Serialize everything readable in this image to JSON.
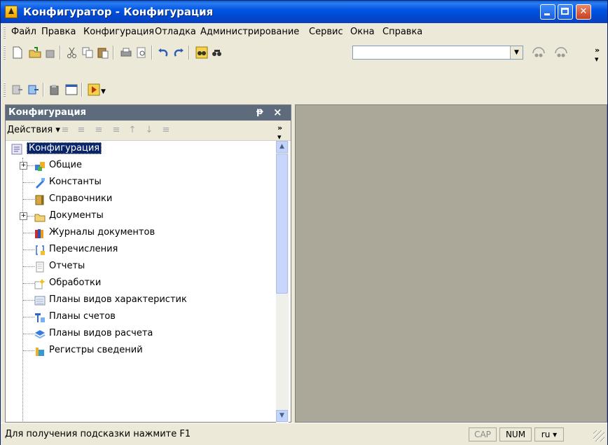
{
  "window": {
    "title": "Конфигуратор - Конфигурация"
  },
  "menu": [
    {
      "label": "Файл"
    },
    {
      "label": "Правка"
    },
    {
      "label": "Конфигурация"
    },
    {
      "label": "Отладка"
    },
    {
      "label": "Администрирование"
    },
    {
      "label": "Сервис"
    },
    {
      "label": "Окна"
    },
    {
      "label": "Справка"
    }
  ],
  "toolbar": {
    "search_value": ""
  },
  "panel": {
    "title": "Конфигурация",
    "pin": "ᵽ",
    "close": "×",
    "actions_label": "Действия ▾"
  },
  "tree": [
    {
      "label": "Конфигурация",
      "icon": "config-icon",
      "expandable": false,
      "selected": true
    },
    {
      "label": "Общие",
      "icon": "common-icon",
      "expandable": true
    },
    {
      "label": "Константы",
      "icon": "constants-icon",
      "expandable": false
    },
    {
      "label": "Справочники",
      "icon": "catalogs-icon",
      "expandable": false
    },
    {
      "label": "Документы",
      "icon": "documents-icon",
      "expandable": true
    },
    {
      "label": "Журналы документов",
      "icon": "journals-icon",
      "expandable": false
    },
    {
      "label": "Перечисления",
      "icon": "enums-icon",
      "expandable": false
    },
    {
      "label": "Отчеты",
      "icon": "reports-icon",
      "expandable": false
    },
    {
      "label": "Обработки",
      "icon": "processing-icon",
      "expandable": false
    },
    {
      "label": "Планы видов характеристик",
      "icon": "char-types-icon",
      "expandable": false
    },
    {
      "label": "Планы счетов",
      "icon": "accounts-icon",
      "expandable": false
    },
    {
      "label": "Планы видов расчета",
      "icon": "calc-types-icon",
      "expandable": false
    },
    {
      "label": "Регистры сведений",
      "icon": "info-registers-icon",
      "expandable": false
    }
  ],
  "status": {
    "hint": "Для получения подсказки нажмите F1",
    "cap": "CAP",
    "num": "NUM",
    "lang": "ru ▾"
  },
  "colors": {
    "title_bar": "#0055e5",
    "panel_header": "#5e6b7d",
    "workspace": "#aca899"
  }
}
